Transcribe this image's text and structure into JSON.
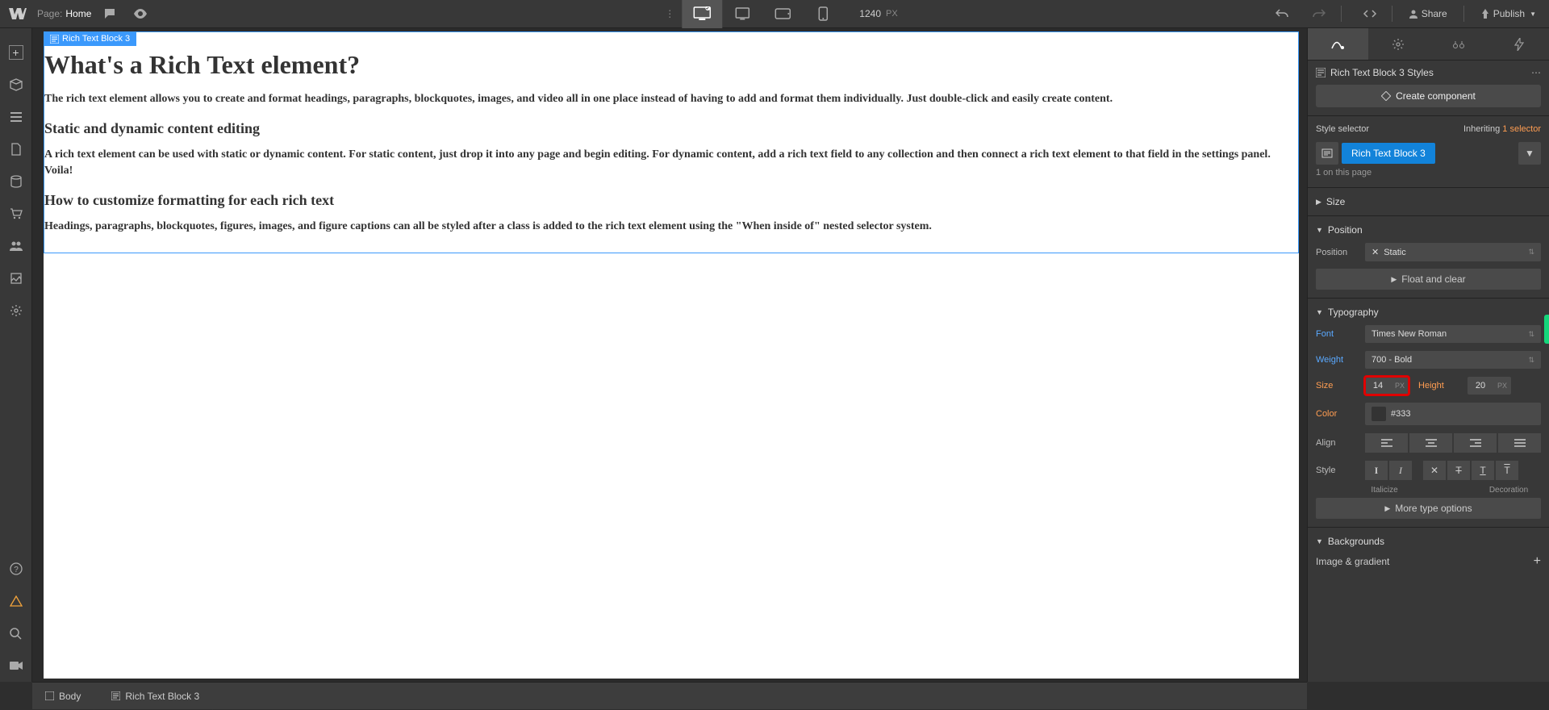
{
  "topbar": {
    "page_label": "Page:",
    "page_name": "Home",
    "width_value": "1240",
    "width_unit": "PX",
    "share": "Share",
    "publish": "Publish"
  },
  "canvas": {
    "selected_badge": "Rich Text Block 3",
    "h1": "What's a Rich Text element?",
    "p1": "The rich text element allows you to create and format headings, paragraphs, blockquotes, images, and video all in one place instead of having to add and format them individually. Just double-click and easily create content.",
    "h2a": "Static and dynamic content editing",
    "p2": "A rich text element can be used with static or dynamic content. For static content, just drop it into any page and begin editing. For dynamic content, add a rich text field to any collection and then connect a rich text element to that field in the settings panel. Voila!",
    "h2b": "How to customize formatting for each rich text",
    "p3": "Headings, paragraphs, blockquotes, figures, images, and figure captions can all be styled after a class is added to the rich text element using the \"When inside of\" nested selector system."
  },
  "breadcrumb": {
    "b1": "Body",
    "b2": "Rich Text Block 3"
  },
  "panel": {
    "header_title": "Rich Text Block 3 Styles",
    "create_component": "Create component",
    "style_selector_label": "Style selector",
    "inheriting_label": "Inheriting",
    "inheriting_link": "1 selector",
    "style_tag": "Rich Text Block 3",
    "on_page": "1 on this page",
    "sections": {
      "size": "Size",
      "position": "Position",
      "typography": "Typography",
      "backgrounds": "Backgrounds"
    },
    "position": {
      "label": "Position",
      "value": "Static",
      "float_clear": "Float and clear"
    },
    "typography": {
      "font_label": "Font",
      "font_value": "Times New Roman",
      "weight_label": "Weight",
      "weight_value": "700 - Bold",
      "size_label": "Size",
      "size_value": "14",
      "size_unit": "PX",
      "height_label": "Height",
      "height_value": "20",
      "height_unit": "PX",
      "color_label": "Color",
      "color_value": "#333",
      "align_label": "Align",
      "style_label": "Style",
      "italicize": "Italicize",
      "decoration": "Decoration",
      "more": "More type options"
    },
    "backgrounds": {
      "image_gradient": "Image & gradient"
    }
  }
}
